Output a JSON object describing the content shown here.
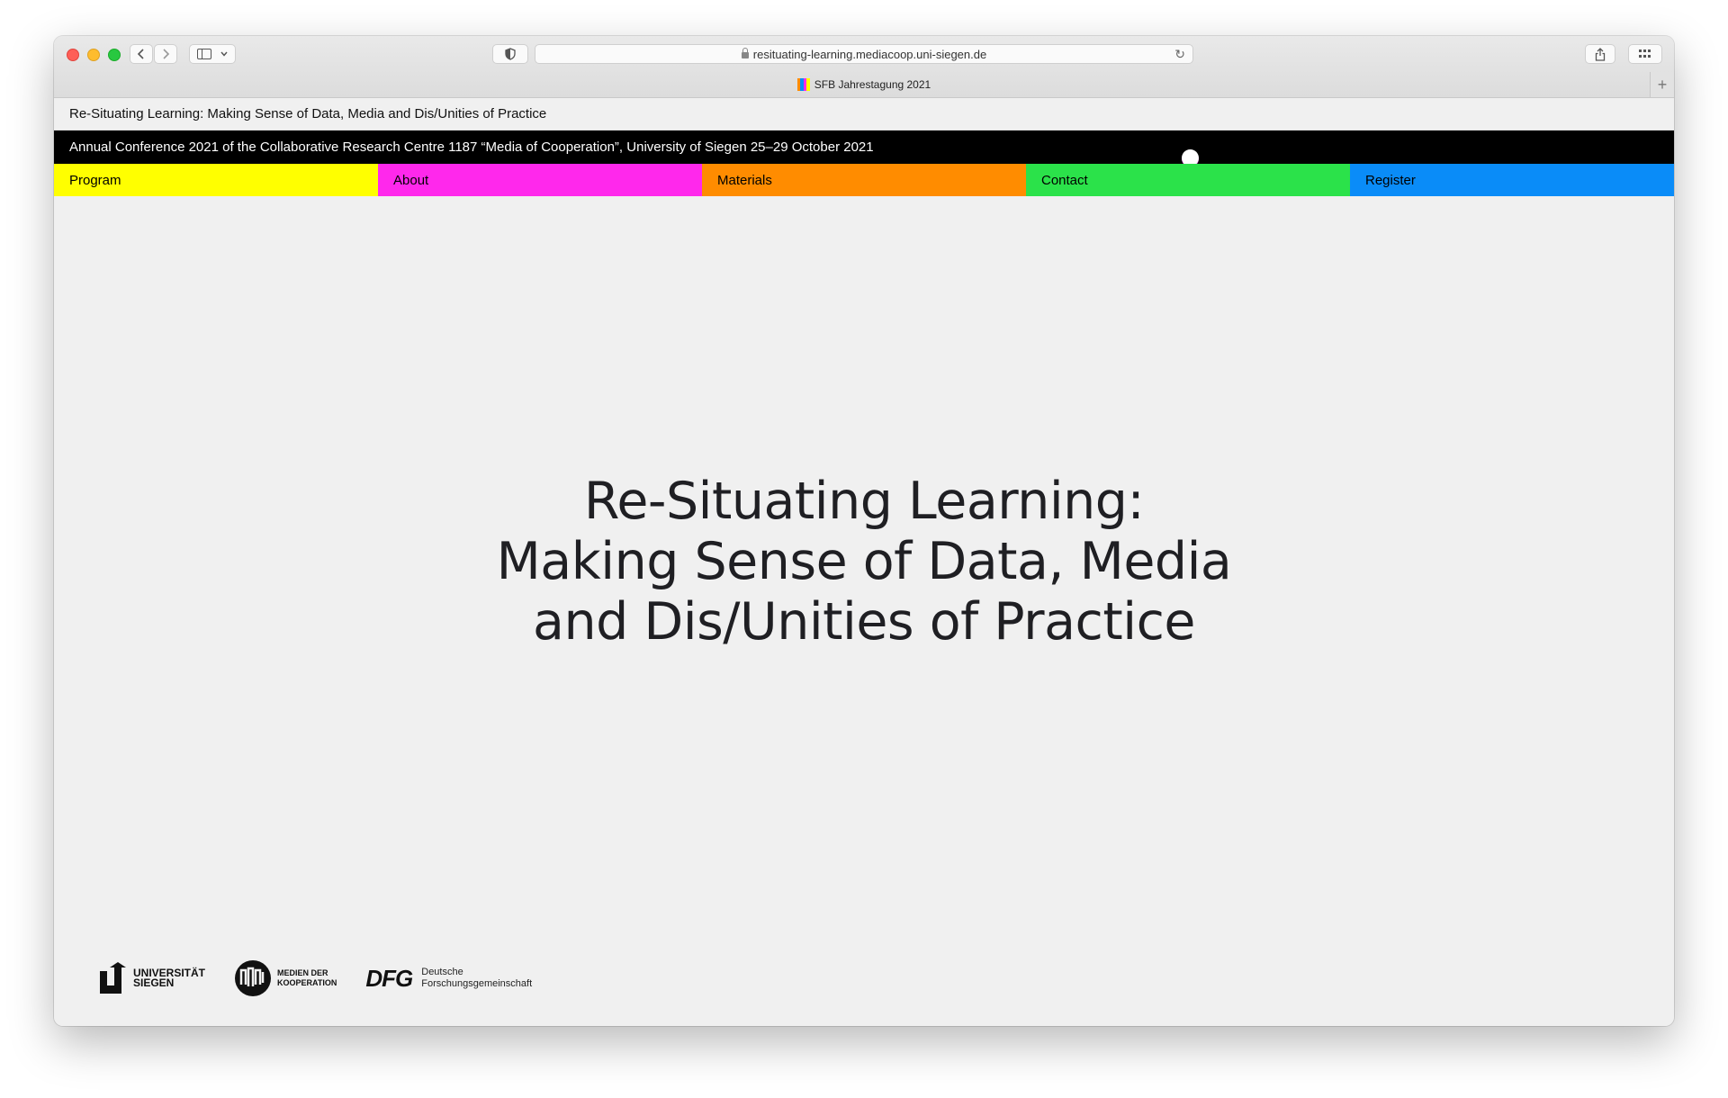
{
  "browser": {
    "url": "resituating-learning.mediacoop.uni-siegen.de",
    "tab_title": "SFB Jahrestagung 2021",
    "new_tab": "+"
  },
  "site": {
    "title": "Re-Situating Learning: Making Sense of Data, Media and Dis/Unities of Practice",
    "announcement": "Annual Conference 2021 of the Collaborative Research Centre 1187 “Media of Cooperation”, University of Siegen 25–29 October 2021"
  },
  "nav": [
    {
      "label": "Program",
      "color": "#ffff00"
    },
    {
      "label": "About",
      "color": "#ff28ec"
    },
    {
      "label": "Materials",
      "color": "#ff8c00"
    },
    {
      "label": "Contact",
      "color": "#2be24a"
    },
    {
      "label": "Register",
      "color": "#0a8cf8"
    }
  ],
  "hero": {
    "lines": [
      "Re-Situating Learning:",
      "Making Sense of Data, Media",
      "and Dis/Unities of Practice"
    ]
  },
  "logos": {
    "siegen": [
      "UNIVERSITÄT",
      "SIEGEN"
    ],
    "medien": [
      "MEDIEN DER",
      "KOOPERATION"
    ],
    "dfg_mark": "DFG",
    "dfg": [
      "Deutsche",
      "Forschungsgemeinschaft"
    ]
  }
}
